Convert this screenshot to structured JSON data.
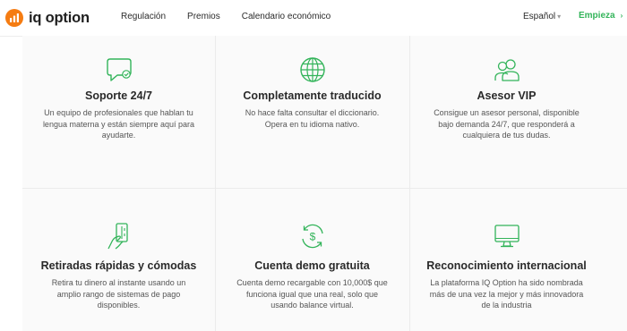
{
  "brand": {
    "name": "iq option",
    "accent": "#33b45a",
    "logo_color": "#f57c12"
  },
  "nav": {
    "items": [
      "Regulación",
      "Premios",
      "Calendario económico"
    ]
  },
  "header_right": {
    "language": "Español",
    "cta": "Empieza"
  },
  "features": [
    {
      "icon": "chat-bubble-check-icon",
      "title": "Soporte 24/7",
      "desc": "Un equipo de profesionales que hablan tu lengua materna y están siempre aquí para ayudarte."
    },
    {
      "icon": "globe-icon",
      "title": "Completamente traducido",
      "desc": "No hace falta consultar el diccionario. Opera en tu idioma nativo."
    },
    {
      "icon": "users-icon",
      "title": "Asesor VIP",
      "desc": "Consigue un asesor personal, disponible bajo demanda 24/7, que responderá a cualquiera de tus dudas."
    },
    {
      "icon": "hand-card-icon",
      "title": "Retiradas rápidas y cómodas",
      "desc": "Retira tu dinero al instante usando un amplio rango de sistemas de pago disponibles."
    },
    {
      "icon": "dollar-cycle-icon",
      "title": "Cuenta demo gratuita",
      "desc": "Cuenta demo recargable con 10,000$ que funciona igual que una real, solo que usando balance virtual."
    },
    {
      "icon": "monitor-icon",
      "title": "Reconocimiento internacional",
      "desc": "La plataforma IQ Option ha sido nombrada más de una vez la mejor y más innovadora de la industria"
    }
  ]
}
